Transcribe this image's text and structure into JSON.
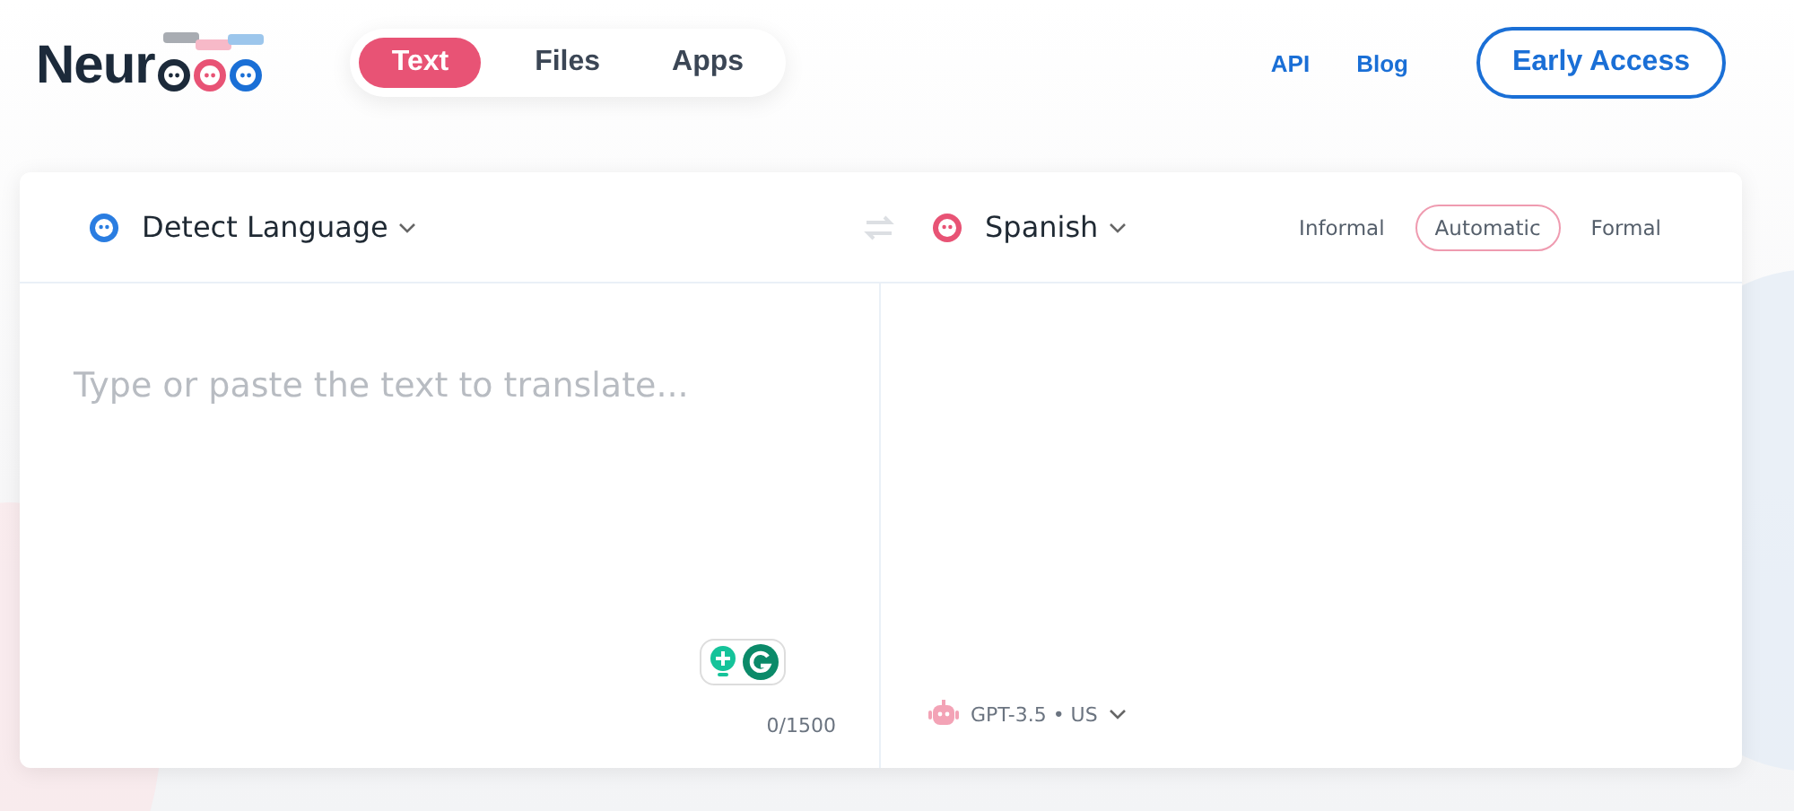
{
  "logo": {
    "text": "Neur"
  },
  "nav_tabs": [
    {
      "label": "Text",
      "selected": true
    },
    {
      "label": "Files",
      "selected": false
    },
    {
      "label": "Apps",
      "selected": false
    }
  ],
  "header_links": [
    "API",
    "Blog"
  ],
  "cta_button": "Early Access",
  "source": {
    "language": "Detect Language",
    "placeholder": "Type or paste the text to translate...",
    "char_count": "0/1500"
  },
  "target": {
    "language": "Spanish",
    "model": "GPT-3.5 • US"
  },
  "tone_options": [
    {
      "label": "Informal",
      "selected": false
    },
    {
      "label": "Automatic",
      "selected": true
    },
    {
      "label": "Formal",
      "selected": false
    }
  ]
}
